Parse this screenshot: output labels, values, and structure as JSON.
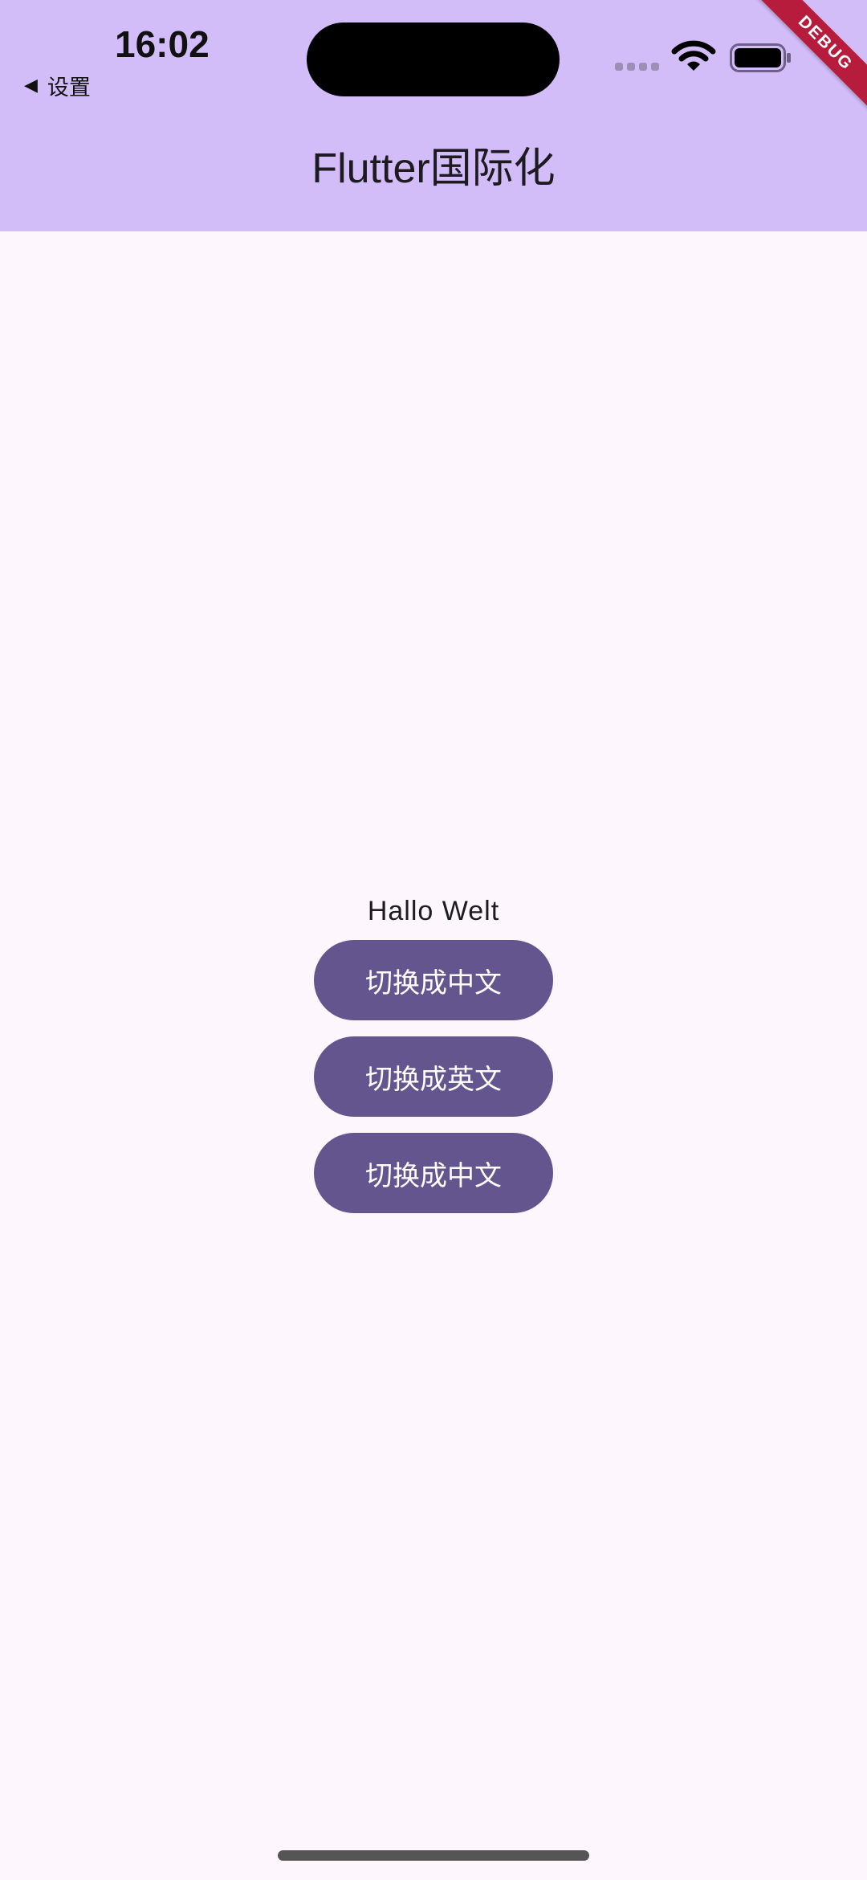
{
  "status_bar": {
    "time": "16:02",
    "back_label": "设置",
    "back_icon": "back-triangle-icon",
    "wifi_icon": "wifi-icon",
    "battery_icon": "battery-icon"
  },
  "debug_banner": "DEBUG",
  "app_bar": {
    "title": "Flutter国际化"
  },
  "main": {
    "greeting": "Hallo Welt",
    "buttons": [
      {
        "label": "切换成中文"
      },
      {
        "label": "切换成英文"
      },
      {
        "label": "切换成中文"
      }
    ]
  },
  "colors": {
    "app_bar": "#d3bdf8",
    "background": "#fdf7fd",
    "button": "#65558f",
    "button_text": "#ffffff",
    "debug_banner": "#b71c3c"
  }
}
